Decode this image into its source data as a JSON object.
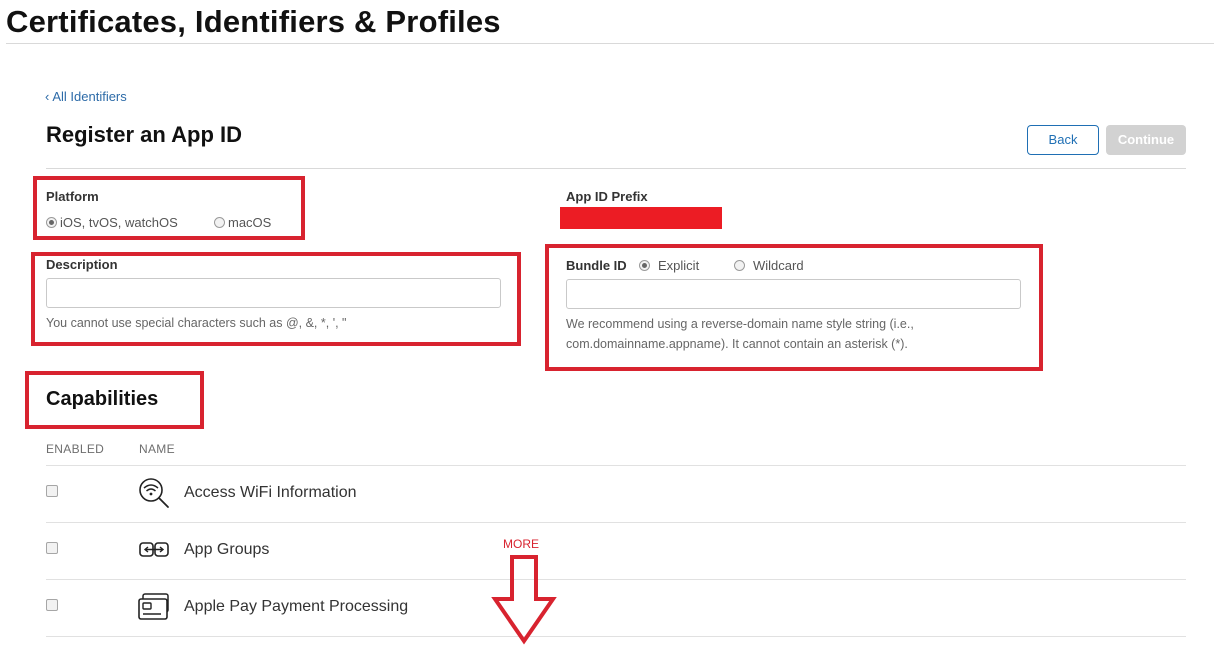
{
  "header": {
    "title": "Certificates, Identifiers & Profiles"
  },
  "nav": {
    "back_link": "All Identifiers"
  },
  "page": {
    "title": "Register an App ID",
    "back_button": "Back",
    "continue_button": "Continue"
  },
  "platform": {
    "label": "Platform",
    "options": [
      {
        "label": "iOS, tvOS, watchOS",
        "selected": true
      },
      {
        "label": "macOS",
        "selected": false
      }
    ]
  },
  "app_id_prefix": {
    "label": "App ID Prefix",
    "value_redacted": true
  },
  "description": {
    "label": "Description",
    "value": "",
    "help": "You cannot use special characters such as @, &, *, ', \""
  },
  "bundle_id": {
    "label": "Bundle ID",
    "options": [
      {
        "label": "Explicit",
        "selected": true
      },
      {
        "label": "Wildcard",
        "selected": false
      }
    ],
    "value": "",
    "help_line1": "We recommend using a reverse-domain name style string (i.e.,",
    "help_line2": "com.domainname.appname). It cannot contain an asterisk (*)."
  },
  "capabilities": {
    "title": "Capabilities",
    "columns": [
      "ENABLED",
      "NAME"
    ],
    "items": [
      {
        "name": "Access WiFi Information",
        "icon": "wifi-search-icon",
        "enabled": false
      },
      {
        "name": "App Groups",
        "icon": "app-groups-icon",
        "enabled": false
      },
      {
        "name": "Apple Pay Payment Processing",
        "icon": "apple-pay-card-icon",
        "enabled": false
      }
    ]
  },
  "annotations": {
    "more_label": "MORE",
    "highlight_color": "#d8232f"
  }
}
